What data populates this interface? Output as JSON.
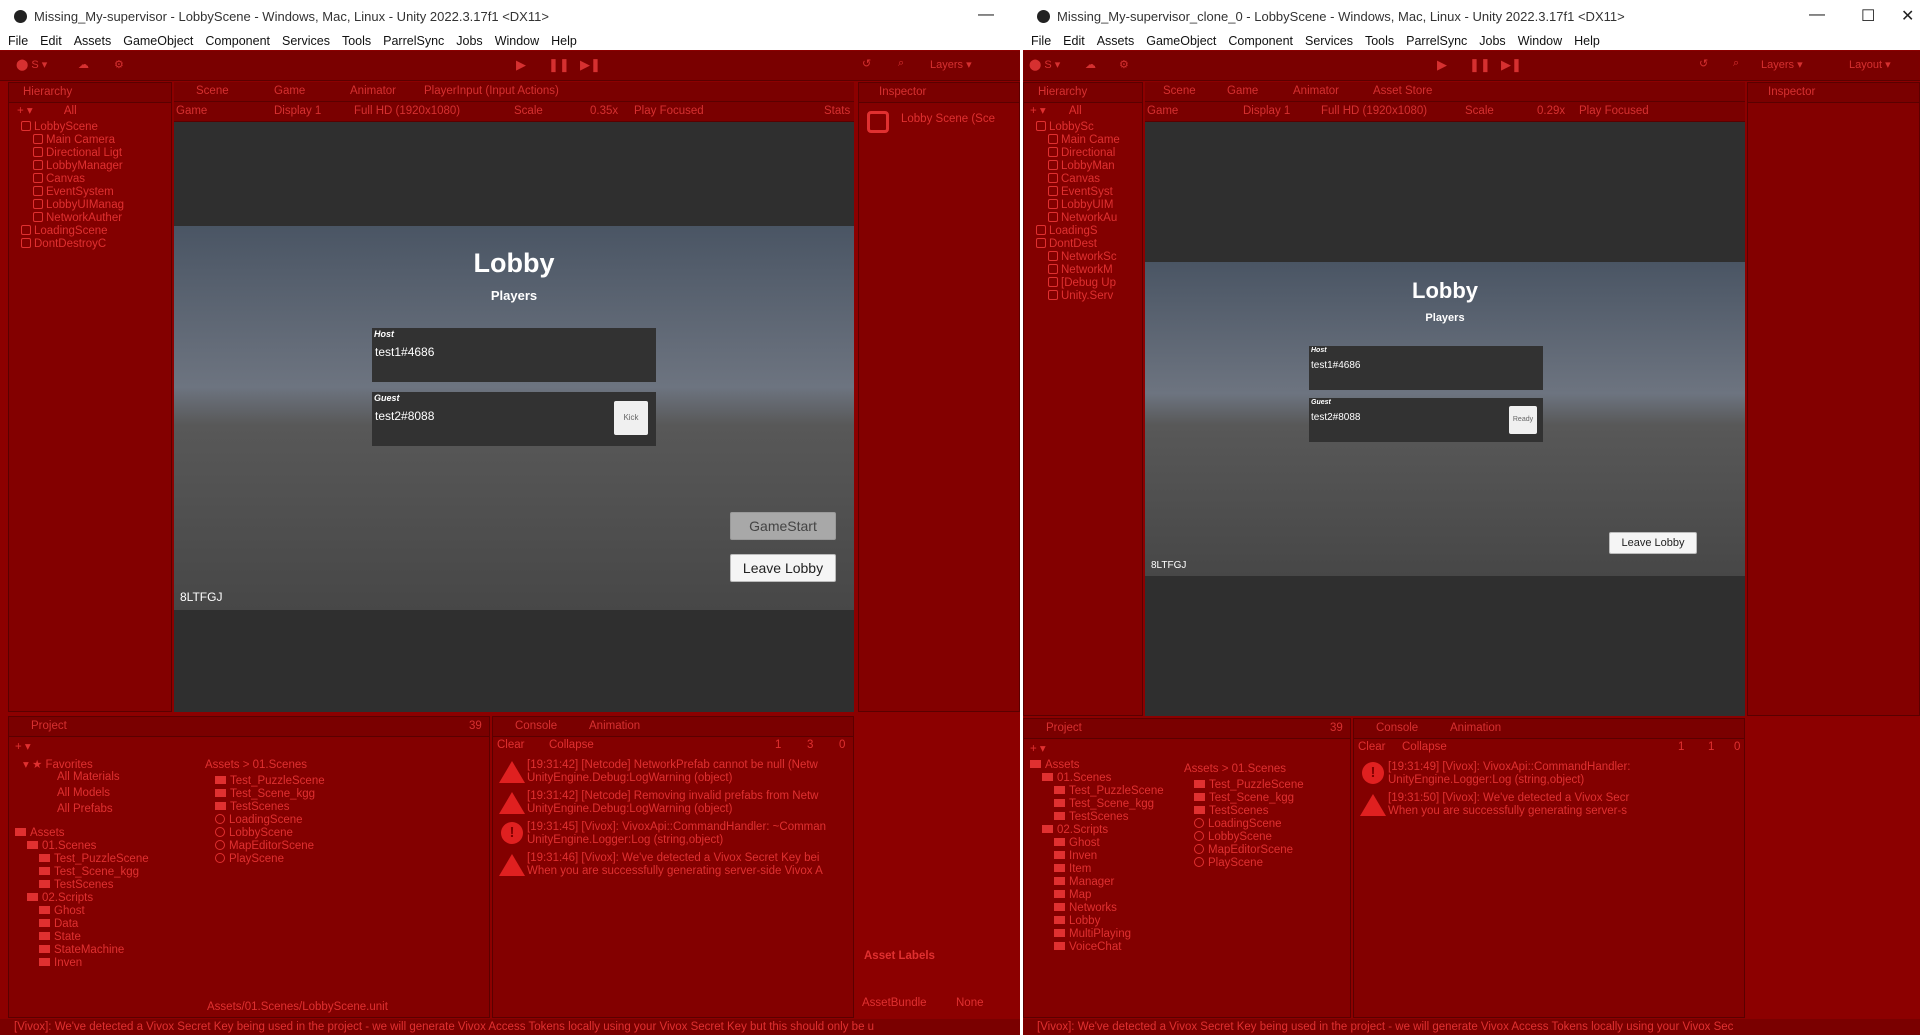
{
  "left": {
    "title": "Missing_My-supervisor - LobbyScene - Windows, Mac, Linux - Unity 2022.3.17f1 <DX11>",
    "menu": [
      "File",
      "Edit",
      "Assets",
      "GameObject",
      "Component",
      "Services",
      "Tools",
      "ParrelSync",
      "Jobs",
      "Window",
      "Help"
    ],
    "tabs": {
      "hierarchy": "Hierarchy",
      "scene": "Scene",
      "game": "Game",
      "animator": "Animator",
      "playerinput": "PlayerInput (Input Actions)",
      "inspector": "Inspector",
      "project": "Project",
      "console": "Console",
      "animation": "Animation"
    },
    "game_bar": {
      "game": "Game",
      "display": "Display 1",
      "resolution": "Full HD (1920x1080)",
      "scale_label": "Scale",
      "scale": "0.35x",
      "play_focused": "Play Focused",
      "stats": "Stats"
    },
    "search_all": "All",
    "hierarchy": [
      {
        "label": "LobbyScene",
        "indent": 0,
        "root": true
      },
      {
        "label": "Main Camera",
        "indent": 1
      },
      {
        "label": "Directional Ligt",
        "indent": 1
      },
      {
        "label": "LobbyManager",
        "indent": 1
      },
      {
        "label": "Canvas",
        "indent": 1
      },
      {
        "label": "EventSystem",
        "indent": 1
      },
      {
        "label": "LobbyUIManag",
        "indent": 1
      },
      {
        "label": "NetworkAuther",
        "indent": 1
      },
      {
        "label": "LoadingScene",
        "indent": 0,
        "root": true
      },
      {
        "label": "DontDestroyC",
        "indent": 0,
        "root": true
      }
    ],
    "inspector_label": "Lobby Scene (Sce",
    "asset_labels": "Asset Labels",
    "asset_bundle": "AssetBundle",
    "asset_bundle_value": "None",
    "game": {
      "title": "Lobby",
      "subtitle": "Players",
      "host_label": "Host",
      "host_name": "test1#4686",
      "guest_label": "Guest",
      "guest_name": "test2#8088",
      "kick": "Kick",
      "gamestart": "GameStart",
      "leave": "Leave Lobby",
      "code": "8LTFGJ"
    },
    "favorites": {
      "title": "Favorites",
      "items": [
        "All Materials",
        "All Models",
        "All Prefabs"
      ]
    },
    "assets_tree": {
      "title": "Assets",
      "items": [
        "01.Scenes",
        "Test_PuzzleScene",
        "Test_Scene_kgg",
        "TestScenes",
        "02.Scripts",
        "Ghost",
        "Data",
        "State",
        "StateMachine",
        "Inven"
      ]
    },
    "breadcrumb": {
      "root": "Assets",
      "sep": ">",
      "child": "01.Scenes"
    },
    "files": [
      "Test_PuzzleScene",
      "Test_Scene_kgg",
      "TestScenes",
      "LoadingScene",
      "LobbyScene",
      "MapEditorScene",
      "PlayScene"
    ],
    "path": "Assets/01.Scenes/LobbyScene.unit",
    "count": "39",
    "console": {
      "clear": "Clear",
      "collapse": "Collapse",
      "err_count": "1",
      "warn_count": "3",
      "info_count": "0",
      "entries": [
        {
          "type": "warn",
          "line1": "[19:31:42] [Netcode] NetworkPrefab cannot be null (Netw",
          "line2": "UnityEngine.Debug:LogWarning (object)"
        },
        {
          "type": "warn",
          "line1": "[19:31:42] [Netcode] Removing invalid prefabs from Netw",
          "line2": "UnityEngine.Debug:LogWarning (object)"
        },
        {
          "type": "err",
          "line1": "[19:31:45] [Vivox]: VivoxApi::CommandHandler: ~Comman",
          "line2": "UnityEngine.Logger:Log (string,object)"
        },
        {
          "type": "warn",
          "line1": "[19:31:46] [Vivox]: We've detected a Vivox Secret Key bei",
          "line2": "When you are successfully generating server-side Vivox A"
        }
      ]
    },
    "status": "[Vivox]: We've detected a Vivox Secret Key being used in the project - we will generate Vivox Access Tokens locally using your Vivox Secret Key but this should only be u"
  },
  "right": {
    "title": "Missing_My-supervisor_clone_0 - LobbyScene - Windows, Mac, Linux - Unity 2022.3.17f1 <DX11>",
    "menu": [
      "File",
      "Edit",
      "Assets",
      "GameObject",
      "Component",
      "Services",
      "Tools",
      "ParrelSync",
      "Jobs",
      "Window",
      "Help"
    ],
    "tabs": {
      "hierarchy": "Hierarchy",
      "scene": "Scene",
      "game": "Game",
      "animator": "Animator",
      "assetstore": "Asset Store",
      "inspector": "Inspector",
      "project": "Project",
      "console": "Console",
      "animation": "Animation"
    },
    "layers": "Layers",
    "layout": "Layout",
    "game_bar": {
      "game": "Game",
      "display": "Display 1",
      "resolution": "Full HD (1920x1080)",
      "scale_label": "Scale",
      "scale": "0.29x",
      "play_focused": "Play Focused"
    },
    "search_all": "All",
    "hierarchy": [
      {
        "label": "LobbySc",
        "indent": 0,
        "root": true
      },
      {
        "label": "Main Came",
        "indent": 1
      },
      {
        "label": "Directional",
        "indent": 1
      },
      {
        "label": "LobbyMan",
        "indent": 1
      },
      {
        "label": "Canvas",
        "indent": 1
      },
      {
        "label": "EventSyst",
        "indent": 1
      },
      {
        "label": "LobbyUIM",
        "indent": 1
      },
      {
        "label": "NetworkAu",
        "indent": 1
      },
      {
        "label": "LoadingS",
        "indent": 0,
        "root": true
      },
      {
        "label": "DontDest",
        "indent": 0,
        "root": true
      },
      {
        "label": "NetworkSc",
        "indent": 1
      },
      {
        "label": "NetworkM",
        "indent": 1
      },
      {
        "label": "[Debug Up",
        "indent": 1
      },
      {
        "label": "Unity.Serv",
        "indent": 1
      }
    ],
    "game": {
      "title": "Lobby",
      "subtitle": "Players",
      "host_label": "Host",
      "host_name": "test1#4686",
      "guest_label": "Guest",
      "guest_name": "test2#8088",
      "ready": "Ready",
      "leave": "Leave Lobby",
      "code": "8LTFGJ"
    },
    "assets_tree": {
      "title": "Assets",
      "items": [
        "01.Scenes",
        "Test_PuzzleScene",
        "Test_Scene_kgg",
        "TestScenes",
        "02.Scripts",
        "Ghost",
        "Inven",
        "Item",
        "Manager",
        "Map",
        "Networks",
        "Lobby",
        "MultiPlaying",
        "VoiceChat"
      ]
    },
    "breadcrumb": {
      "root": "Assets",
      "sep": ">",
      "child": "01.Scenes"
    },
    "files": [
      "Test_PuzzleScene",
      "Test_Scene_kgg",
      "TestScenes",
      "LoadingScene",
      "LobbyScene",
      "MapEditorScene",
      "PlayScene"
    ],
    "count": "39",
    "console": {
      "clear": "Clear",
      "collapse": "Collapse",
      "err_count": "1",
      "warn_count": "1",
      "info_count": "0",
      "entries": [
        {
          "type": "err",
          "line1": "[19:31:49] [Vivox]: VivoxApi::CommandHandler:",
          "line2": "UnityEngine.Logger:Log (string,object)"
        },
        {
          "type": "warn",
          "line1": "[19:31:50] [Vivox]: We've detected a Vivox Secr",
          "line2": "When you are successfully generating server-s"
        }
      ]
    },
    "status": "[Vivox]: We've detected a Vivox Secret Key being used in the project - we will generate Vivox Access Tokens locally using your Vivox Sec"
  },
  "colors": {
    "accent": "#e03030",
    "panel": "#830000",
    "toolbar": "#7a0000",
    "gameText": "#ffffff"
  }
}
